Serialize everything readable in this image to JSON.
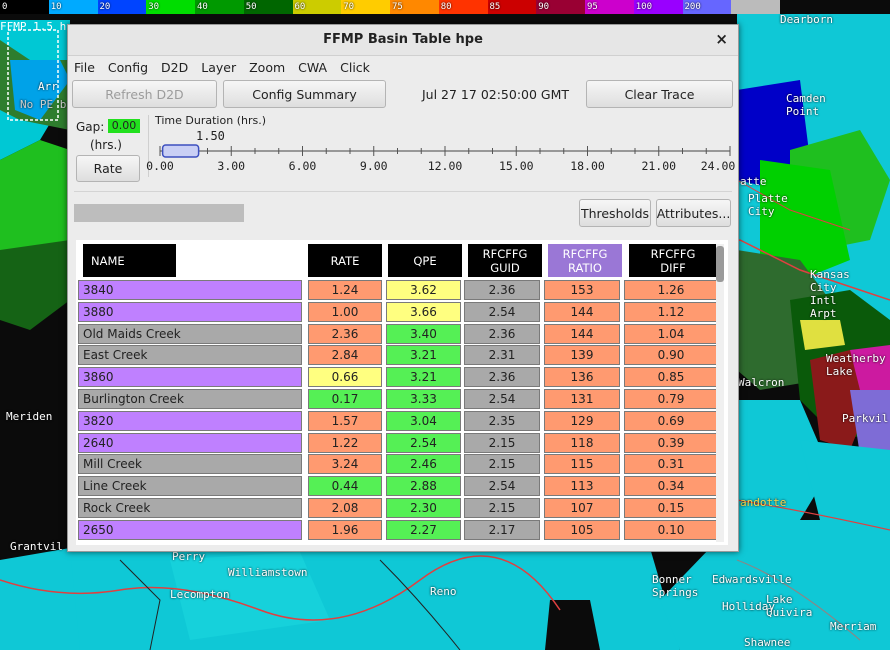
{
  "colorbar": {
    "labels": [
      "0",
      "10",
      "20",
      "30",
      "40",
      "50",
      "60",
      "70",
      "75",
      "80",
      "85",
      "90",
      "95",
      "100",
      "200"
    ],
    "colors": [
      "#000000",
      "#00aaff",
      "#0044ff",
      "#00dd00",
      "#009900",
      "#006600",
      "#cccc00",
      "#ffcc00",
      "#ff8800",
      "#ff3300",
      "#cc0000",
      "#990033",
      "#cc00cc",
      "#9900ff",
      "#6666ff",
      "#bbbbbb"
    ]
  },
  "frame_label": "FFMP 1.5 hou",
  "map_labels": [
    {
      "id": "arr",
      "text": "Arr"
    },
    {
      "id": "no-pe",
      "text": "No PE b"
    },
    {
      "id": "meriden",
      "text": "Meriden"
    },
    {
      "id": "grantville",
      "text": "Grantvil"
    },
    {
      "id": "perry",
      "text": "Perry"
    },
    {
      "id": "williamstown",
      "text": "Williamstown"
    },
    {
      "id": "lecompton",
      "text": "Lecompton"
    },
    {
      "id": "reno",
      "text": "Reno"
    },
    {
      "id": "bonner-springs",
      "text": "Bonner\nSprings"
    },
    {
      "id": "edwardsville",
      "text": "Edwardsville"
    },
    {
      "id": "lake-quivira",
      "text": "Lake\nQuivira"
    },
    {
      "id": "holliday",
      "text": "Holliday"
    },
    {
      "id": "shawnee",
      "text": "Shawnee"
    },
    {
      "id": "merriam",
      "text": "Merriam"
    },
    {
      "id": "camden-point",
      "text": "Camden\nPoint"
    },
    {
      "id": "platte",
      "text": "Platte\nCity"
    },
    {
      "id": "latte",
      "text": "atte"
    },
    {
      "id": "kansas-city-intl",
      "text": "Kansas\nCity\nIntl\nArpt"
    },
    {
      "id": "weatherby-lake",
      "text": "Weatherby\nLake"
    },
    {
      "id": "walcron",
      "text": "Walcron"
    },
    {
      "id": "parkville",
      "text": "Parkvil"
    },
    {
      "id": "wyandotte",
      "text": "andotte"
    },
    {
      "id": "dearborn",
      "text": "Dearborn"
    }
  ],
  "window": {
    "title": "FFMP Basin Table hpe",
    "close": "×"
  },
  "menu": [
    "File",
    "Config",
    "D2D",
    "Layer",
    "Zoom",
    "CWA",
    "Click"
  ],
  "toolbar": {
    "refresh": "Refresh D2D",
    "config_summary": "Config Summary",
    "datetime": "Jul 27 17 02:50:00 GMT",
    "clear_trace": "Clear Trace"
  },
  "gap": {
    "label": "Gap:",
    "value": "0.00",
    "units": "(hrs.)",
    "rate_button": "Rate"
  },
  "time_duration": {
    "label": "Time Duration (hrs.)",
    "value": "1.50",
    "ticks": [
      "0.00",
      "3.00",
      "6.00",
      "9.00",
      "12.00",
      "15.00",
      "18.00",
      "21.00",
      "24.00"
    ],
    "thumb_hours": 1.5,
    "max_hours": 24
  },
  "buttons": {
    "thresholds": "Thresholds",
    "attributes": "Attributes..."
  },
  "table": {
    "headers": [
      {
        "id": "name",
        "label": "NAME"
      },
      {
        "id": "rate",
        "label": "RATE"
      },
      {
        "id": "qpe",
        "label": "QPE"
      },
      {
        "id": "guid",
        "label": "RFCFFG\nGUID"
      },
      {
        "id": "ratio",
        "label": "RFCFFG\nRATIO"
      },
      {
        "id": "diff",
        "label": "RFCFFG\nDIFF"
      }
    ],
    "header_colors": {
      "normal": "#000000",
      "sorted": "#9a77d6"
    },
    "cell_colors": {
      "purple": "#bf80ff",
      "gray": "#a9a9a9",
      "orange": "#ff9a70",
      "yellow": "#ffff80",
      "green": "#55f055"
    },
    "rows": [
      {
        "name": "3840",
        "name_color": "purple",
        "rate": "1.24",
        "rate_color": "orange",
        "qpe": "3.62",
        "qpe_color": "yellow",
        "guid": "2.36",
        "ratio": "153",
        "diff": "1.26"
      },
      {
        "name": "3880",
        "name_color": "purple",
        "rate": "1.00",
        "rate_color": "orange",
        "qpe": "3.66",
        "qpe_color": "yellow",
        "guid": "2.54",
        "ratio": "144",
        "diff": "1.12"
      },
      {
        "name": "Old Maids Creek",
        "name_color": "gray",
        "rate": "2.36",
        "rate_color": "orange",
        "qpe": "3.40",
        "qpe_color": "green",
        "guid": "2.36",
        "ratio": "144",
        "diff": "1.04"
      },
      {
        "name": "East Creek",
        "name_color": "gray",
        "rate": "2.84",
        "rate_color": "orange",
        "qpe": "3.21",
        "qpe_color": "green",
        "guid": "2.31",
        "ratio": "139",
        "diff": "0.90"
      },
      {
        "name": "3860",
        "name_color": "purple",
        "rate": "0.66",
        "rate_color": "yellow",
        "qpe": "3.21",
        "qpe_color": "green",
        "guid": "2.36",
        "ratio": "136",
        "diff": "0.85"
      },
      {
        "name": "Burlington Creek",
        "name_color": "gray",
        "rate": "0.17",
        "rate_color": "green",
        "qpe": "3.33",
        "qpe_color": "green",
        "guid": "2.54",
        "ratio": "131",
        "diff": "0.79"
      },
      {
        "name": "3820",
        "name_color": "purple",
        "rate": "1.57",
        "rate_color": "orange",
        "qpe": "3.04",
        "qpe_color": "green",
        "guid": "2.35",
        "ratio": "129",
        "diff": "0.69"
      },
      {
        "name": "2640",
        "name_color": "purple",
        "rate": "1.22",
        "rate_color": "orange",
        "qpe": "2.54",
        "qpe_color": "green",
        "guid": "2.15",
        "ratio": "118",
        "diff": "0.39"
      },
      {
        "name": "Mill Creek",
        "name_color": "gray",
        "rate": "3.24",
        "rate_color": "orange",
        "qpe": "2.46",
        "qpe_color": "green",
        "guid": "2.15",
        "ratio": "115",
        "diff": "0.31"
      },
      {
        "name": "Line Creek",
        "name_color": "gray",
        "rate": "0.44",
        "rate_color": "green",
        "qpe": "2.88",
        "qpe_color": "green",
        "guid": "2.54",
        "ratio": "113",
        "diff": "0.34"
      },
      {
        "name": "Rock Creek",
        "name_color": "gray",
        "rate": "2.08",
        "rate_color": "orange",
        "qpe": "2.30",
        "qpe_color": "green",
        "guid": "2.15",
        "ratio": "107",
        "diff": "0.15"
      },
      {
        "name": "2650",
        "name_color": "purple",
        "rate": "1.96",
        "rate_color": "orange",
        "qpe": "2.27",
        "qpe_color": "green",
        "guid": "2.17",
        "ratio": "105",
        "diff": "0.10"
      }
    ]
  }
}
